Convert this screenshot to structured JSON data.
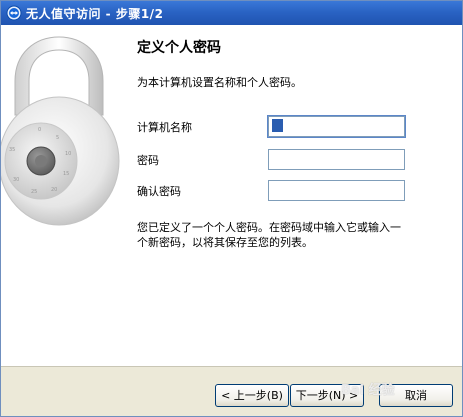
{
  "window": {
    "title": "无人值守访问 - 步骤1/2"
  },
  "page": {
    "heading": "定义个人密码",
    "subtitle": "为本计算机设置名称和个人密码。",
    "fields": {
      "computer_name_label": "计算机名称",
      "computer_name_value": "",
      "password_label": "密码",
      "password_value": "",
      "confirm_label": "确认密码",
      "confirm_value": ""
    },
    "note": "您已定义了一个个人密码。在密码域中输入它或输入一个新密码，以将其保存至您的列表。"
  },
  "buttons": {
    "back": "< 上一步(B)",
    "next": "下一步(N) >",
    "cancel": "取消"
  },
  "watermark": "Bai 经验",
  "colors": {
    "titlebar": "#2a63c4",
    "bottom_bar": "#ece9d8"
  },
  "icons": {
    "title": "teamviewer-icon",
    "lock": "combination-padlock-icon"
  }
}
